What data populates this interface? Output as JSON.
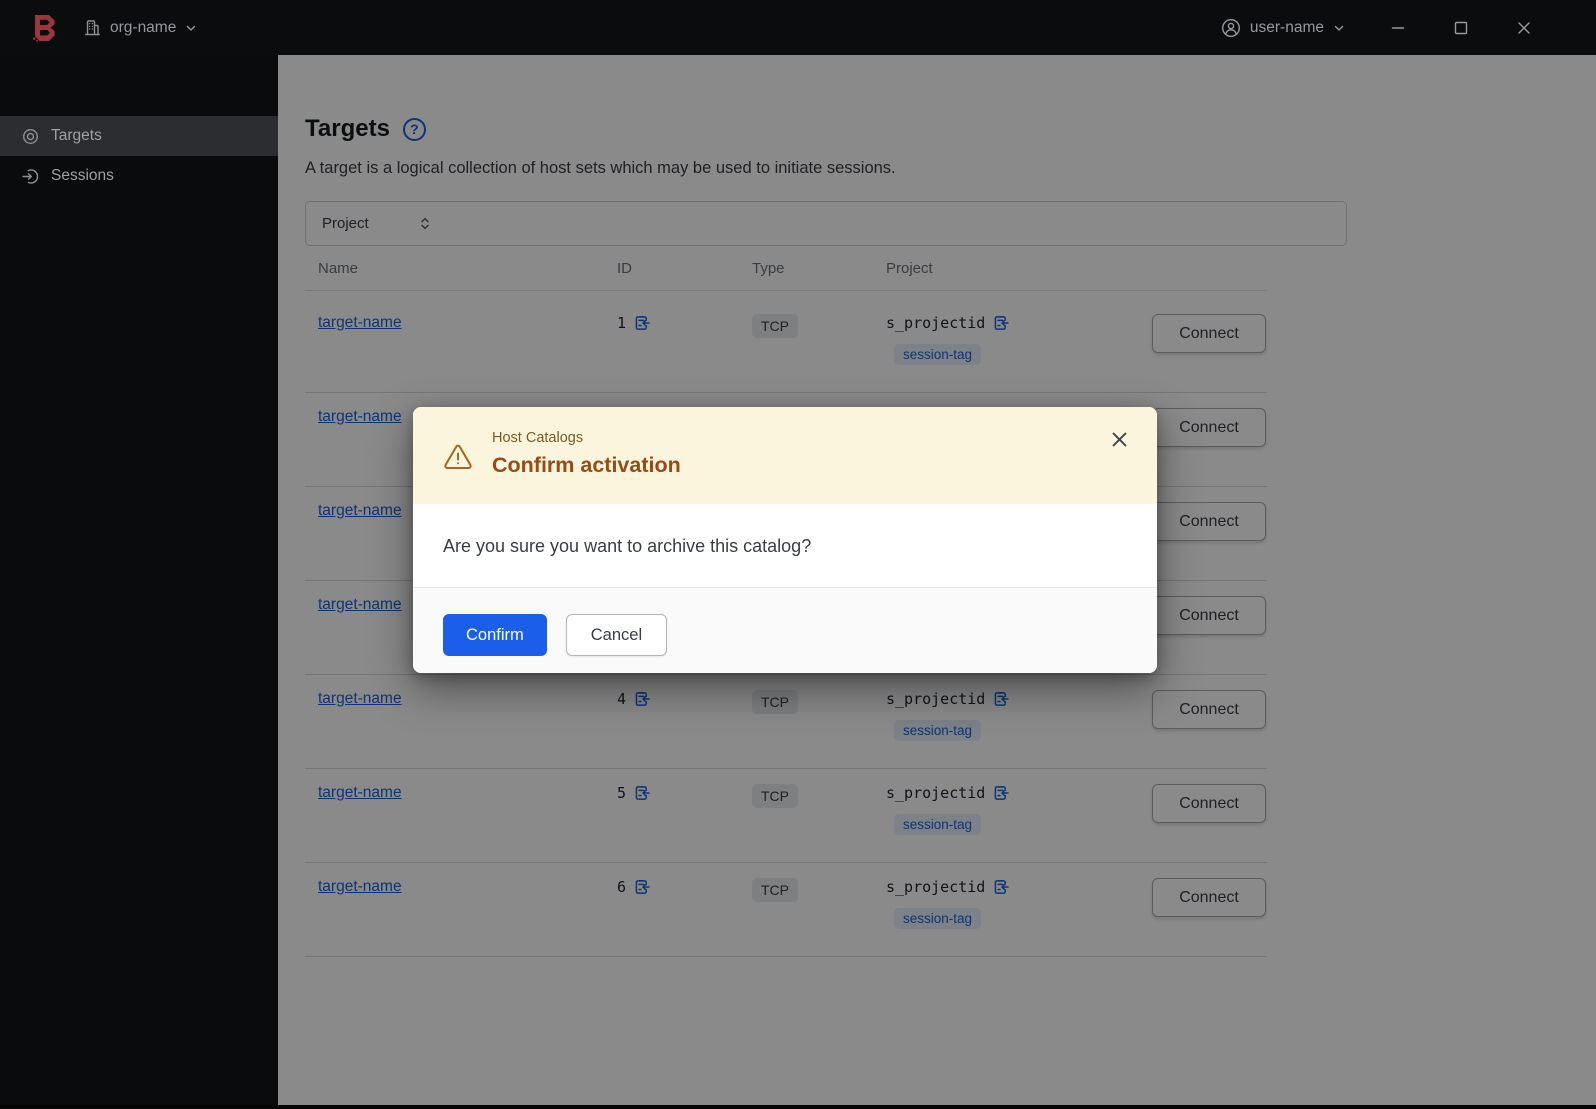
{
  "topbar": {
    "org_name": "org-name",
    "user_name": "user-name"
  },
  "sidebar": {
    "items": [
      {
        "label": "Targets",
        "icon": "target-icon",
        "active": true
      },
      {
        "label": "Sessions",
        "icon": "entry-icon",
        "active": false
      }
    ]
  },
  "page": {
    "title": "Targets",
    "help_glyph": "?",
    "description": "A target is a logical collection of host sets which may be used to initiate sessions.",
    "filter": {
      "label": "Project"
    },
    "table": {
      "columns": [
        "Name",
        "ID",
        "Type",
        "Project"
      ],
      "connect_label": "Connect",
      "rows": [
        {
          "name": "target-name",
          "id": "1",
          "type": "TCP",
          "project": "s_projectid",
          "tag": "session-tag"
        },
        {
          "name": "target-name",
          "id": "",
          "type": "",
          "project": "",
          "tag": ""
        },
        {
          "name": "target-name",
          "id": "",
          "type": "",
          "project": "",
          "tag": ""
        },
        {
          "name": "target-name",
          "id": "",
          "type": "",
          "project": "",
          "tag": ""
        },
        {
          "name": "target-name",
          "id": "4",
          "type": "TCP",
          "project": "s_projectid",
          "tag": "session-tag"
        },
        {
          "name": "target-name",
          "id": "5",
          "type": "TCP",
          "project": "s_projectid",
          "tag": "session-tag"
        },
        {
          "name": "target-name",
          "id": "6",
          "type": "TCP",
          "project": "s_projectid",
          "tag": "session-tag"
        }
      ]
    }
  },
  "modal": {
    "tagline": "Host Catalogs",
    "title": "Confirm activation",
    "message": "Are you sure you want to archive this catalog?",
    "confirm_label": "Confirm",
    "cancel_label": "Cancel"
  },
  "colors": {
    "accent_blue": "#1c61d8",
    "confirm_blue": "#1a5eea",
    "logo_red": "#9a363d",
    "warning_title": "#9a4a12",
    "warning_tagline": "#7c5a22",
    "modal_header_bg": "#fcf5dd",
    "tag_bg": "#e7f0fc",
    "type_badge_bg": "#e9eaec",
    "text_dark": "#3b3d45"
  }
}
